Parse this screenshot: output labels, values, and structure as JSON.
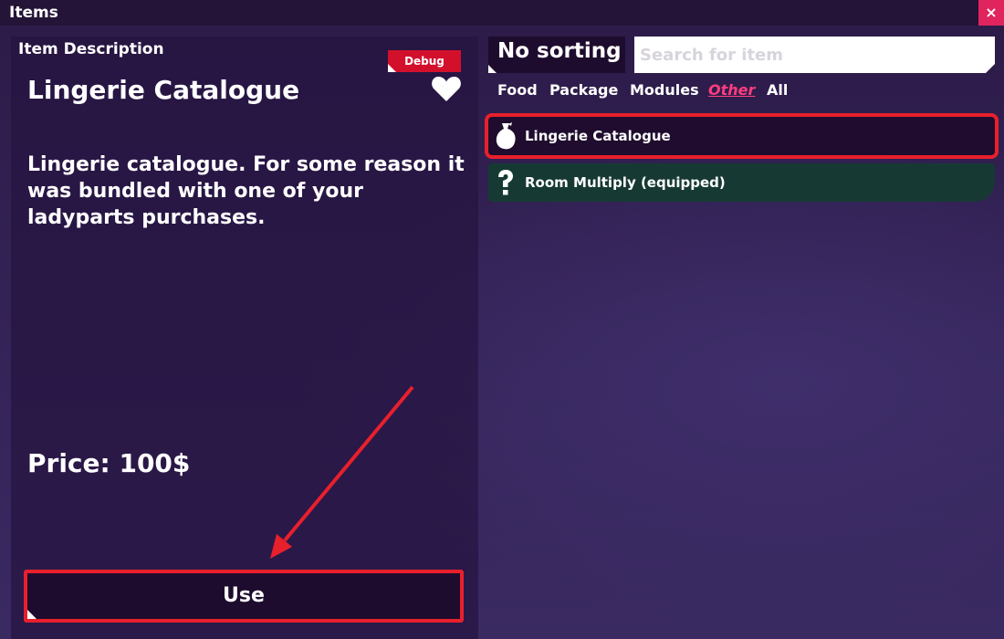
{
  "window": {
    "title": "Items",
    "close_label": "×"
  },
  "description_panel": {
    "header": "Item Description",
    "debug_tag": "Debug",
    "item_name": "Lingerie Catalogue",
    "favorite_icon": "heart-icon",
    "description": "Lingerie catalogue. For some reason it was bundled with one of your ladyparts purchases.",
    "price": "Price: 100$",
    "use_label": "Use"
  },
  "sorting": {
    "label": "No sorting"
  },
  "search": {
    "placeholder": "Search for item",
    "value": ""
  },
  "filters": [
    {
      "label": "Food",
      "active": false
    },
    {
      "label": "Package",
      "active": false
    },
    {
      "label": "Modules",
      "active": false
    },
    {
      "label": "Other",
      "active": true
    },
    {
      "label": "All",
      "active": false
    }
  ],
  "items": [
    {
      "label": "Lingerie Catalogue",
      "icon": "pouch-icon",
      "selected": true
    },
    {
      "label": "Room Multiply (equipped)",
      "icon": "question-mark-icon",
      "selected": false
    }
  ],
  "colors": {
    "accent": "#e8202c",
    "close": "#e0245e",
    "active_filter": "#ff3d7f",
    "equipped_bg": "#163a33",
    "panel_bg": "#1e0c2e"
  }
}
